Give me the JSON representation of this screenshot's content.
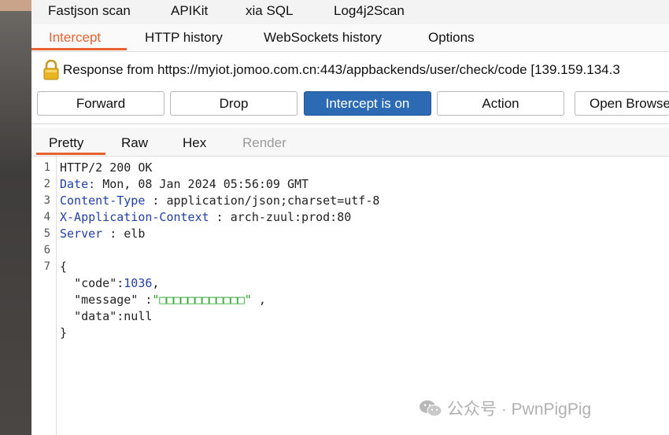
{
  "extension_tabs": [
    "Fastjson scan",
    "APIKit",
    "xia SQL",
    "Log4j2Scan"
  ],
  "sub_tabs": {
    "intercept": "Intercept",
    "http_history": "HTTP history",
    "websockets_history": "WebSockets history",
    "options": "Options"
  },
  "response_line": "Response from https://myiot.jomoo.com.cn:443/appbackends/user/check/code  [139.159.134.3",
  "buttons": {
    "forward": "Forward",
    "drop": "Drop",
    "intercept_on": "Intercept is on",
    "action": "Action",
    "open_browser": "Open Browse"
  },
  "view_tabs": {
    "pretty": "Pretty",
    "raw": "Raw",
    "hex": "Hex",
    "render": "Render"
  },
  "line_numbers": [
    "1",
    "2",
    "3",
    "4",
    "5",
    "6",
    "7"
  ],
  "http": {
    "status": "HTTP/2 200 OK",
    "headers": [
      {
        "name": "Date",
        "value": "Mon, 08 Jan 2024 05:56:09 GMT"
      },
      {
        "name": "Content-Type",
        "value": "application/json;charset=utf-8"
      },
      {
        "name": "X-Application-Context",
        "value": "arch-zuul:prod:80"
      },
      {
        "name": "Server",
        "value": "elb"
      }
    ]
  },
  "body": {
    "open_brace": "{",
    "close_brace": "}",
    "code_key": "\"code\"",
    "code_value": "1036",
    "message_key": "\"message\"",
    "message_value": "\"□□□□□□□□□□□□\"",
    "data_key": "\"data\"",
    "data_value": "null"
  },
  "watermark": "公众号 · PwnPigPig",
  "colors": {
    "accent": "#e8622f",
    "intercept_button": "#2c6bb3",
    "header_key": "#2240a8",
    "string_value": "#20a020"
  }
}
